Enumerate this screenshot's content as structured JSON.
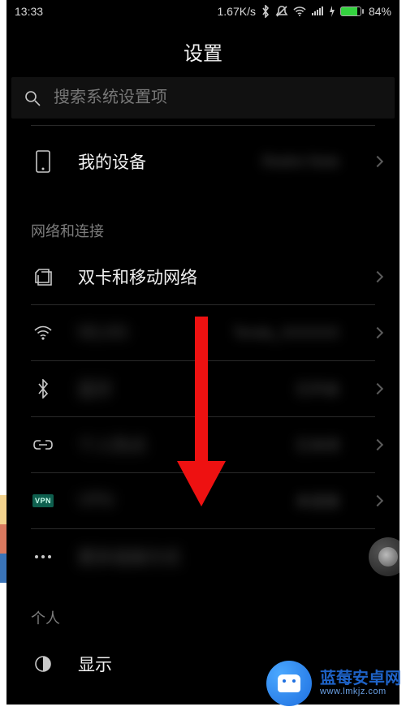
{
  "statusbar": {
    "time": "13:33",
    "net_speed": "1.67K/s",
    "battery_pct": "84%"
  },
  "title": "设置",
  "search": {
    "placeholder": "搜索系统设置项"
  },
  "rows": {
    "my_device": {
      "label": "我的设备",
      "value": "Redmi Note"
    },
    "sim": {
      "label": "双卡和移动网络"
    },
    "wlan": {
      "label": "WLAN",
      "value": "Tenda_XXXXXX"
    },
    "bt": {
      "label": "蓝牙",
      "value": "已开启"
    },
    "hotspot": {
      "label": "个人热点",
      "value": "已关闭"
    },
    "vpn": {
      "label": "VPN",
      "value": "未连接",
      "badge": "VPN"
    },
    "more": {
      "label": "更多连接方式"
    },
    "display": {
      "label": "显示"
    }
  },
  "sections": {
    "network": "网络和连接",
    "personal": "个人"
  },
  "watermark": {
    "cn": "蓝莓安卓网",
    "en": "www.lmkjz.com"
  }
}
